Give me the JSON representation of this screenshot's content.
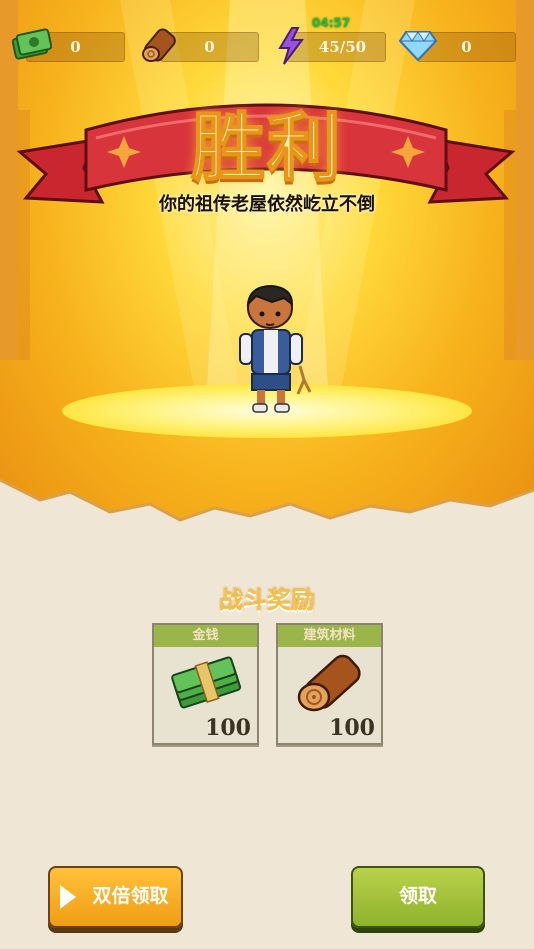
{
  "resources": {
    "cash": "0",
    "wood": "0",
    "energy": "45/50",
    "energy_timer": "04:57",
    "gems": "0"
  },
  "banner": {
    "title": "胜利",
    "subtitle": "你的祖传老屋依然屹立不倒"
  },
  "rewards": {
    "title": "战斗奖励",
    "items": [
      {
        "label": "金钱",
        "amount": "100",
        "icon": "cash-stack-icon"
      },
      {
        "label": "建筑材料",
        "amount": "100",
        "icon": "wood-log-icon"
      }
    ]
  },
  "buttons": {
    "double_claim": "双倍领取",
    "claim": "领取"
  },
  "colors": {
    "gold": "#f7b21c",
    "banner_red": "#d8343b",
    "green_button": "#9ab64a",
    "orange_button": "#f09d14"
  }
}
